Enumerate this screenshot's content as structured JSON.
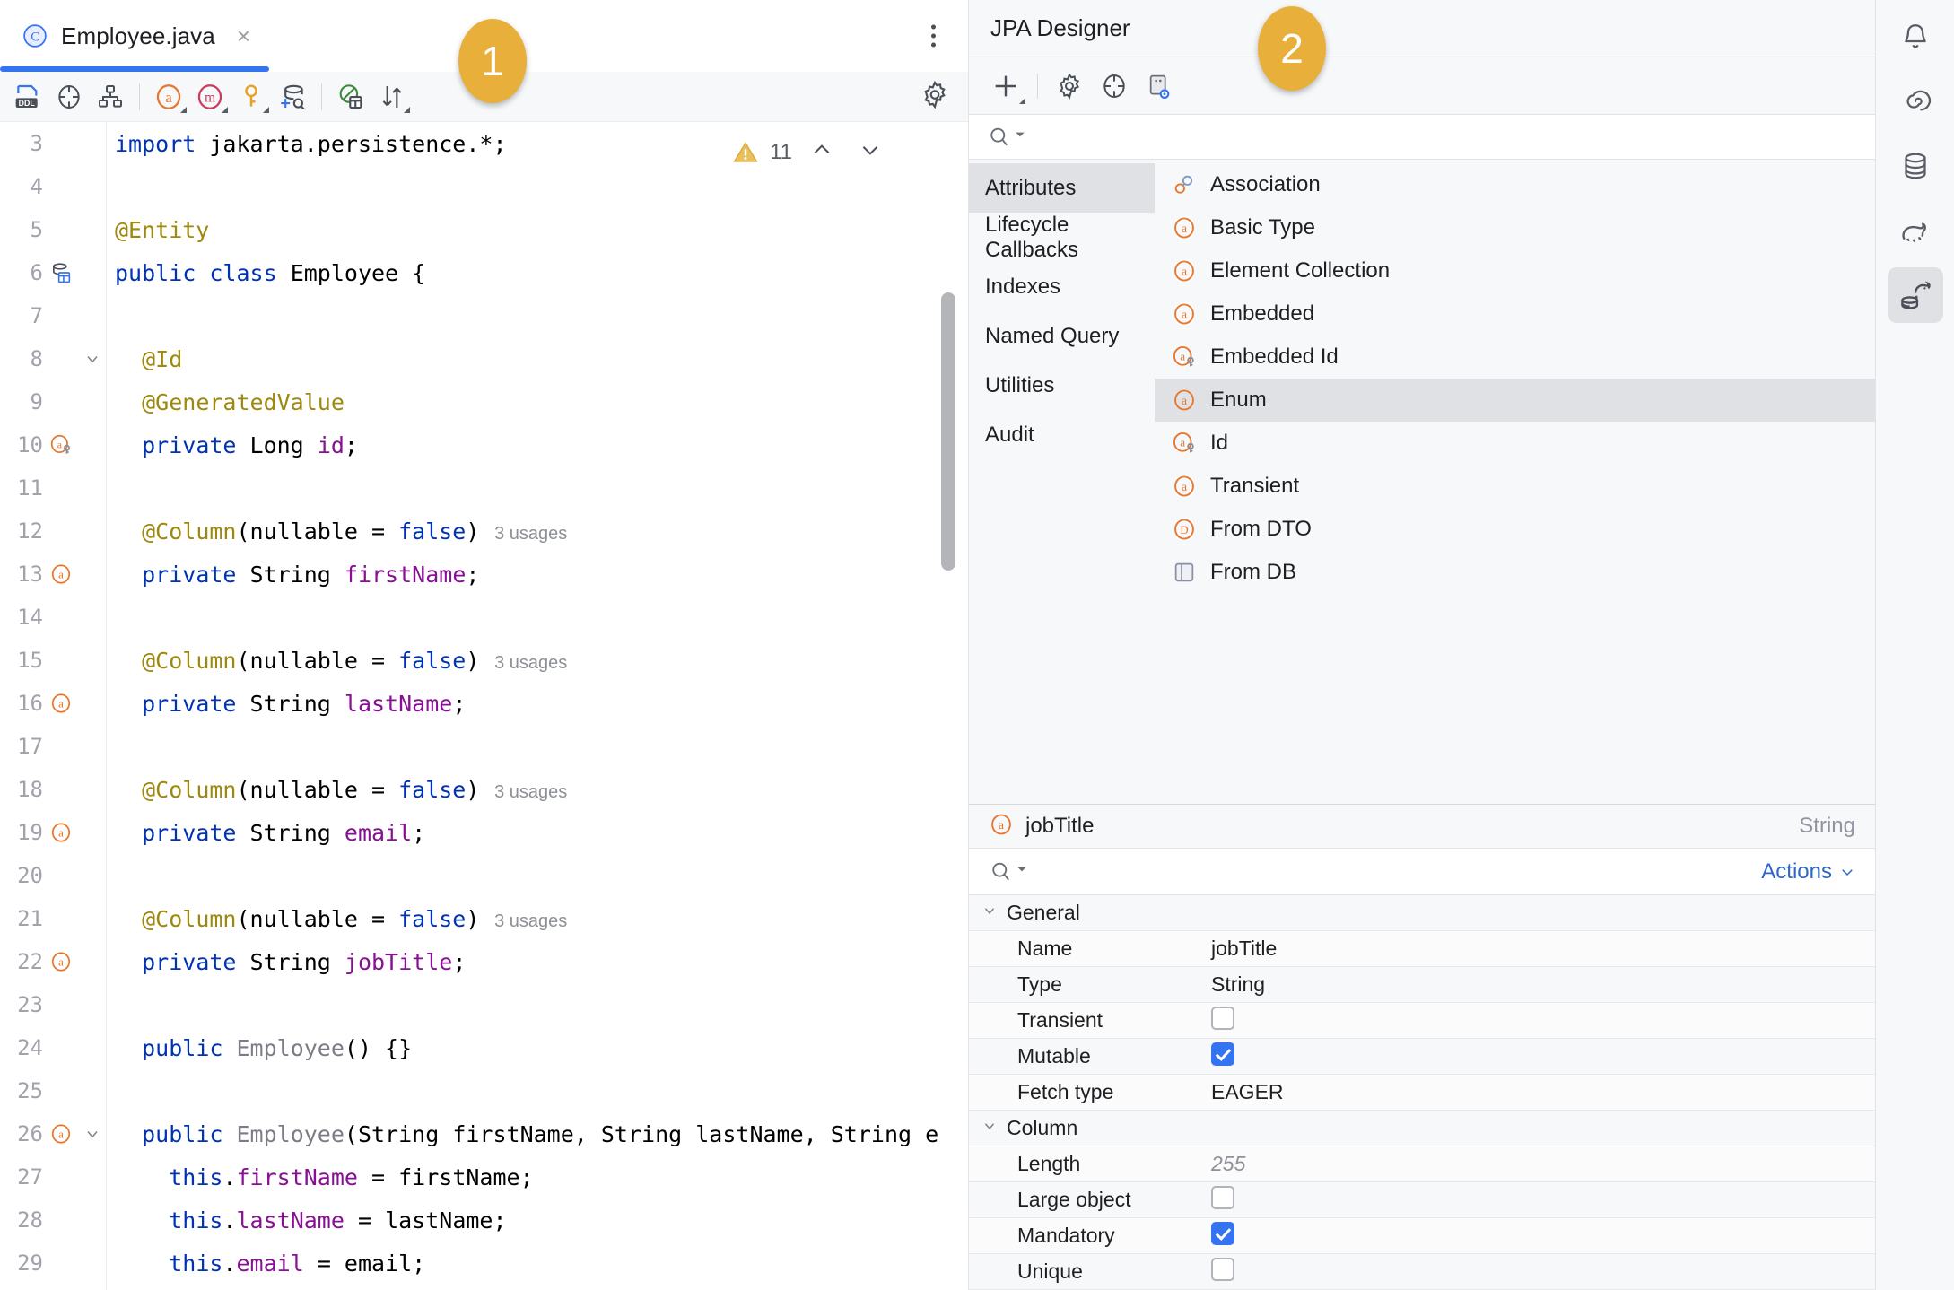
{
  "editor": {
    "tab": {
      "label": "Employee.java",
      "icon": "java-class-icon",
      "close_label": "×"
    },
    "tab_menu_name": "tab-options-menu",
    "toolbar": {
      "buttons": [
        {
          "name": "generate-ddl-icon",
          "label": "DDL"
        },
        {
          "name": "jpa-console-icon",
          "label": ""
        },
        {
          "name": "entity-diagram-icon",
          "label": ""
        },
        {
          "name": "add-attribute-icon",
          "label": ""
        },
        {
          "name": "add-method-icon",
          "label": ""
        },
        {
          "name": "add-id-icon",
          "label": ""
        },
        {
          "name": "add-database-icon",
          "label": ""
        },
        {
          "name": "jpa-mapping-icon",
          "label": ""
        },
        {
          "name": "sync-icon",
          "label": ""
        }
      ],
      "settings_name": "editor-settings-gear-icon"
    },
    "inspection": {
      "warning_count": "11",
      "prev_name": "previous-problem-chevron",
      "next_name": "next-problem-chevron"
    },
    "code_lines": [
      {
        "num": "3",
        "gutter": "",
        "fold": "",
        "segments": [
          {
            "t": "import",
            "c": "k"
          },
          {
            "t": " ",
            "c": "ws"
          },
          {
            "t": "jakarta.persistence.*;",
            "c": "cls"
          }
        ]
      },
      {
        "num": "4",
        "gutter": "",
        "fold": "",
        "segments": []
      },
      {
        "num": "5",
        "gutter": "",
        "fold": "",
        "segments": [
          {
            "t": "@Entity",
            "c": "ann"
          }
        ]
      },
      {
        "num": "6",
        "gutter": "table-icon",
        "fold": "",
        "segments": [
          {
            "t": "public",
            "c": "k"
          },
          {
            "t": " ",
            "c": "ws"
          },
          {
            "t": "class",
            "c": "k"
          },
          {
            "t": " ",
            "c": "ws"
          },
          {
            "t": "Employee",
            "c": "cls"
          },
          {
            "t": " {",
            "c": "cls"
          }
        ]
      },
      {
        "num": "7",
        "gutter": "",
        "fold": "",
        "segments": []
      },
      {
        "num": "8",
        "gutter": "",
        "fold": "v",
        "segments": [
          {
            "t": "  ",
            "c": "ws"
          },
          {
            "t": "@Id",
            "c": "ann"
          }
        ]
      },
      {
        "num": "9",
        "gutter": "",
        "fold": "",
        "segments": [
          {
            "t": "  ",
            "c": "ws"
          },
          {
            "t": "@GeneratedValue",
            "c": "ann"
          }
        ]
      },
      {
        "num": "10",
        "gutter": "id-attr-icon",
        "fold": "",
        "segments": [
          {
            "t": "  ",
            "c": "ws"
          },
          {
            "t": "private",
            "c": "k"
          },
          {
            "t": " ",
            "c": "ws"
          },
          {
            "t": "Long",
            "c": "cls"
          },
          {
            "t": " ",
            "c": "ws"
          },
          {
            "t": "id",
            "c": "fld"
          },
          {
            "t": ";",
            "c": "cls"
          }
        ]
      },
      {
        "num": "11",
        "gutter": "",
        "fold": "",
        "segments": []
      },
      {
        "num": "12",
        "gutter": "",
        "fold": "",
        "segments": [
          {
            "t": "  ",
            "c": "ws"
          },
          {
            "t": "@Column",
            "c": "ann"
          },
          {
            "t": "(nullable ",
            "c": "cls"
          },
          {
            "t": "= ",
            "c": "cls"
          },
          {
            "t": "false",
            "c": "k"
          },
          {
            "t": ")",
            "c": "cls"
          },
          {
            "t": "   3 usages",
            "c": "usages"
          }
        ]
      },
      {
        "num": "13",
        "gutter": "attr-icon",
        "fold": "",
        "segments": [
          {
            "t": "  ",
            "c": "ws"
          },
          {
            "t": "private",
            "c": "k"
          },
          {
            "t": " ",
            "c": "ws"
          },
          {
            "t": "String",
            "c": "cls"
          },
          {
            "t": " ",
            "c": "ws"
          },
          {
            "t": "firstName",
            "c": "fld"
          },
          {
            "t": ";",
            "c": "cls"
          }
        ]
      },
      {
        "num": "14",
        "gutter": "",
        "fold": "",
        "segments": []
      },
      {
        "num": "15",
        "gutter": "",
        "fold": "",
        "segments": [
          {
            "t": "  ",
            "c": "ws"
          },
          {
            "t": "@Column",
            "c": "ann"
          },
          {
            "t": "(nullable ",
            "c": "cls"
          },
          {
            "t": "= ",
            "c": "cls"
          },
          {
            "t": "false",
            "c": "k"
          },
          {
            "t": ")",
            "c": "cls"
          },
          {
            "t": "   3 usages",
            "c": "usages"
          }
        ]
      },
      {
        "num": "16",
        "gutter": "attr-icon",
        "fold": "",
        "segments": [
          {
            "t": "  ",
            "c": "ws"
          },
          {
            "t": "private",
            "c": "k"
          },
          {
            "t": " ",
            "c": "ws"
          },
          {
            "t": "String",
            "c": "cls"
          },
          {
            "t": " ",
            "c": "ws"
          },
          {
            "t": "lastName",
            "c": "fld"
          },
          {
            "t": ";",
            "c": "cls"
          }
        ]
      },
      {
        "num": "17",
        "gutter": "",
        "fold": "",
        "segments": []
      },
      {
        "num": "18",
        "gutter": "",
        "fold": "",
        "segments": [
          {
            "t": "  ",
            "c": "ws"
          },
          {
            "t": "@Column",
            "c": "ann"
          },
          {
            "t": "(nullable ",
            "c": "cls"
          },
          {
            "t": "= ",
            "c": "cls"
          },
          {
            "t": "false",
            "c": "k"
          },
          {
            "t": ")",
            "c": "cls"
          },
          {
            "t": "   3 usages",
            "c": "usages"
          }
        ]
      },
      {
        "num": "19",
        "gutter": "attr-icon",
        "fold": "",
        "segments": [
          {
            "t": "  ",
            "c": "ws"
          },
          {
            "t": "private",
            "c": "k"
          },
          {
            "t": " ",
            "c": "ws"
          },
          {
            "t": "String",
            "c": "cls"
          },
          {
            "t": " ",
            "c": "ws"
          },
          {
            "t": "email",
            "c": "fld"
          },
          {
            "t": ";",
            "c": "cls"
          }
        ]
      },
      {
        "num": "20",
        "gutter": "",
        "fold": "",
        "segments": []
      },
      {
        "num": "21",
        "gutter": "",
        "fold": "",
        "segments": [
          {
            "t": "  ",
            "c": "ws"
          },
          {
            "t": "@Column",
            "c": "ann"
          },
          {
            "t": "(nullable ",
            "c": "cls"
          },
          {
            "t": "= ",
            "c": "cls"
          },
          {
            "t": "false",
            "c": "k"
          },
          {
            "t": ")",
            "c": "cls"
          },
          {
            "t": "   3 usages",
            "c": "usages"
          }
        ]
      },
      {
        "num": "22",
        "gutter": "attr-icon",
        "fold": "",
        "segments": [
          {
            "t": "  ",
            "c": "ws"
          },
          {
            "t": "private",
            "c": "k"
          },
          {
            "t": " ",
            "c": "ws"
          },
          {
            "t": "String",
            "c": "cls"
          },
          {
            "t": " ",
            "c": "ws"
          },
          {
            "t": "jobTitle",
            "c": "fld"
          },
          {
            "t": ";",
            "c": "cls"
          }
        ]
      },
      {
        "num": "23",
        "gutter": "",
        "fold": "",
        "segments": []
      },
      {
        "num": "24",
        "gutter": "",
        "fold": "",
        "segments": [
          {
            "t": "  ",
            "c": "ws"
          },
          {
            "t": "public",
            "c": "k"
          },
          {
            "t": " ",
            "c": "ws"
          },
          {
            "t": "Employee",
            "c": "mth"
          },
          {
            "t": "() {}",
            "c": "cls"
          }
        ]
      },
      {
        "num": "25",
        "gutter": "",
        "fold": "",
        "segments": []
      },
      {
        "num": "26",
        "gutter": "attr-icon",
        "fold": "v",
        "segments": [
          {
            "t": "  ",
            "c": "ws"
          },
          {
            "t": "public",
            "c": "k"
          },
          {
            "t": " ",
            "c": "ws"
          },
          {
            "t": "Employee",
            "c": "mth"
          },
          {
            "t": "(String firstName, String lastName, String e",
            "c": "cls"
          }
        ]
      },
      {
        "num": "27",
        "gutter": "",
        "fold": "",
        "segments": [
          {
            "t": "    ",
            "c": "ws"
          },
          {
            "t": "this",
            "c": "k"
          },
          {
            "t": ".",
            "c": "cls"
          },
          {
            "t": "firstName",
            "c": "fld"
          },
          {
            "t": " = firstName;",
            "c": "cls"
          }
        ]
      },
      {
        "num": "28",
        "gutter": "",
        "fold": "",
        "segments": [
          {
            "t": "    ",
            "c": "ws"
          },
          {
            "t": "this",
            "c": "k"
          },
          {
            "t": ".",
            "c": "cls"
          },
          {
            "t": "lastName",
            "c": "fld"
          },
          {
            "t": " = lastName;",
            "c": "cls"
          }
        ]
      },
      {
        "num": "29",
        "gutter": "",
        "fold": "",
        "segments": [
          {
            "t": "    ",
            "c": "ws"
          },
          {
            "t": "this",
            "c": "k"
          },
          {
            "t": ".",
            "c": "cls"
          },
          {
            "t": "email",
            "c": "fld"
          },
          {
            "t": " = email;",
            "c": "cls"
          }
        ]
      }
    ]
  },
  "jpa": {
    "title": "JPA Designer",
    "toolbar": [
      {
        "name": "add-new-icon"
      },
      {
        "name": "settings-gear-icon"
      },
      {
        "name": "jpa-console-icon"
      },
      {
        "name": "show-diagram-icon"
      }
    ],
    "search_placeholder": "",
    "categories": [
      {
        "label": "Attributes",
        "selected": true
      },
      {
        "label": "Lifecycle Callbacks",
        "selected": false
      },
      {
        "label": "Indexes",
        "selected": false
      },
      {
        "label": "Named Query",
        "selected": false
      },
      {
        "label": "Utilities",
        "selected": false
      },
      {
        "label": "Audit",
        "selected": false
      }
    ],
    "items": [
      {
        "label": "Association",
        "icon": "association-icon",
        "highlighted": false
      },
      {
        "label": "Basic Type",
        "icon": "attribute-icon",
        "highlighted": false
      },
      {
        "label": "Element Collection",
        "icon": "attribute-icon",
        "highlighted": false
      },
      {
        "label": "Embedded",
        "icon": "attribute-icon",
        "highlighted": false
      },
      {
        "label": "Embedded Id",
        "icon": "attribute-id-icon",
        "highlighted": false
      },
      {
        "label": "Enum",
        "icon": "attribute-icon",
        "highlighted": true
      },
      {
        "label": "Id",
        "icon": "attribute-id-icon",
        "highlighted": false
      },
      {
        "label": "Transient",
        "icon": "attribute-icon",
        "highlighted": false
      },
      {
        "label": "From DTO",
        "icon": "dto-icon",
        "highlighted": false
      },
      {
        "label": "From DB",
        "icon": "database-table-icon",
        "highlighted": false
      }
    ]
  },
  "properties": {
    "header": {
      "icon": "attribute-icon",
      "name": "jobTitle",
      "type": "String"
    },
    "search_placeholder": "",
    "actions_label": "Actions",
    "groups": [
      {
        "label": "General",
        "rows": [
          {
            "key": "Name",
            "value": "jobTitle",
            "kind": "text",
            "muted": false
          },
          {
            "key": "Type",
            "value": "String",
            "kind": "text",
            "muted": false
          },
          {
            "key": "Transient",
            "value": "",
            "kind": "checkbox",
            "checked": false
          },
          {
            "key": "Mutable",
            "value": "",
            "kind": "checkbox",
            "checked": true
          },
          {
            "key": "Fetch type",
            "value": "EAGER",
            "kind": "text",
            "muted": false
          }
        ]
      },
      {
        "label": "Column",
        "rows": [
          {
            "key": "Length",
            "value": "255",
            "kind": "text",
            "muted": true
          },
          {
            "key": "Large object",
            "value": "",
            "kind": "checkbox",
            "checked": false
          },
          {
            "key": "Mandatory",
            "value": "",
            "kind": "checkbox",
            "checked": true
          },
          {
            "key": "Unique",
            "value": "",
            "kind": "checkbox",
            "checked": false
          }
        ]
      }
    ]
  },
  "stripe": {
    "buttons": [
      {
        "name": "notifications-bell-icon",
        "active": false
      },
      {
        "name": "ai-assistant-icon",
        "active": false
      },
      {
        "name": "database-icon",
        "active": false
      },
      {
        "name": "elephant-postgres-icon",
        "active": false
      },
      {
        "name": "jpa-designer-icon",
        "active": true
      }
    ]
  },
  "callouts": [
    {
      "label": "1"
    },
    {
      "label": "2"
    }
  ],
  "colors": {
    "accent": "#3574f0",
    "badge": "#e8b03a",
    "orange": "#e8762c",
    "annotation": "#9e880d",
    "keyword": "#0033b3",
    "field": "#871094"
  }
}
